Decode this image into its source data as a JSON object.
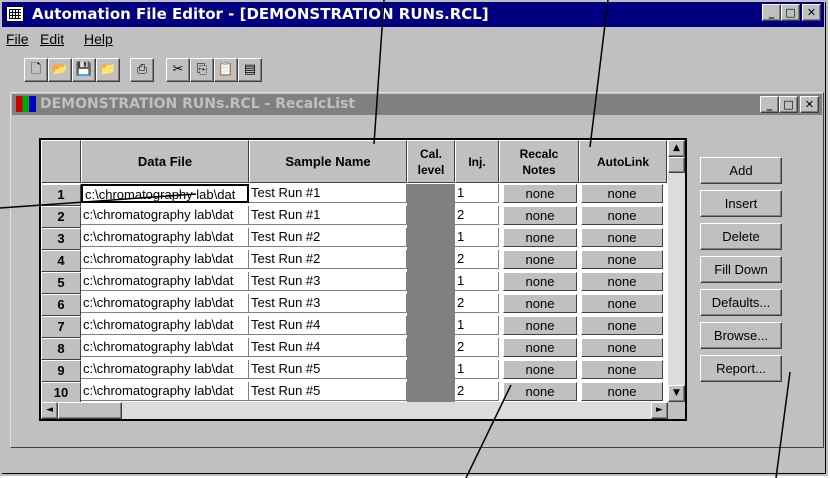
{
  "window": {
    "title": "Automation File Editor - [DEMONSTRATION RUNs.RCL]"
  },
  "menu": [
    "File",
    "Edit",
    "Help"
  ],
  "toolbar_icons": [
    "new-icon",
    "open-icon",
    "save-icon",
    "save-as-icon",
    "print-icon",
    "cut-icon",
    "copy-icon",
    "paste-icon",
    "import-icon"
  ],
  "child": {
    "title": "DEMONSTRATION RUNs.RCL - RecalcList"
  },
  "grid": {
    "headers": {
      "data_file": "Data File",
      "sample_name": "Sample Name",
      "cal_level": "Cal. level",
      "inj": "Inj.",
      "recalc_notes": "Recalc Notes",
      "autolink": "AutoLink"
    },
    "rows": [
      {
        "n": "1",
        "file": "c:\\chromatography lab\\dat",
        "sample": "Test Run #1",
        "inj": "1",
        "notes": "none",
        "link": "none"
      },
      {
        "n": "2",
        "file": "c:\\chromatography lab\\dat",
        "sample": "Test Run #1",
        "inj": "2",
        "notes": "none",
        "link": "none"
      },
      {
        "n": "3",
        "file": "c:\\chromatography lab\\dat",
        "sample": "Test Run #2",
        "inj": "1",
        "notes": "none",
        "link": "none"
      },
      {
        "n": "4",
        "file": "c:\\chromatography lab\\dat",
        "sample": "Test Run #2",
        "inj": "2",
        "notes": "none",
        "link": "none"
      },
      {
        "n": "5",
        "file": "c:\\chromatography lab\\dat",
        "sample": "Test Run #3",
        "inj": "1",
        "notes": "none",
        "link": "none"
      },
      {
        "n": "6",
        "file": "c:\\chromatography lab\\dat",
        "sample": "Test Run #3",
        "inj": "2",
        "notes": "none",
        "link": "none"
      },
      {
        "n": "7",
        "file": "c:\\chromatography lab\\dat",
        "sample": "Test Run #4",
        "inj": "1",
        "notes": "none",
        "link": "none"
      },
      {
        "n": "8",
        "file": "c:\\chromatography lab\\dat",
        "sample": "Test Run #4",
        "inj": "2",
        "notes": "none",
        "link": "none"
      },
      {
        "n": "9",
        "file": "c:\\chromatography lab\\dat",
        "sample": "Test Run #5",
        "inj": "1",
        "notes": "none",
        "link": "none"
      },
      {
        "n": "10",
        "file": "c:\\chromatography lab\\dat",
        "sample": "Test Run #5",
        "inj": "2",
        "notes": "none",
        "link": "none"
      }
    ]
  },
  "buttons": {
    "add": "Add",
    "insert": "Insert",
    "delete": "Delete",
    "fill_down": "Fill Down",
    "defaults": "Defaults...",
    "browse": "Browse...",
    "report": "Report..."
  },
  "colors": {
    "title_active": "#000080",
    "title_inactive": "#808080",
    "face": "#c0c0c0"
  }
}
